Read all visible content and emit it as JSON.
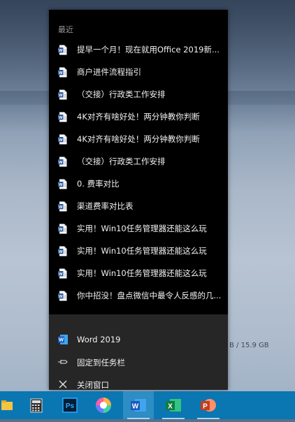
{
  "jumplist": {
    "section_title": "最近",
    "recent_items": [
      {
        "label": "提早一个月！现在就用Office 2019新",
        "ellipsis": "..."
      },
      {
        "label": "商户进件流程指引",
        "ellipsis": ""
      },
      {
        "label": "（交接）行政类工作安排",
        "ellipsis": ""
      },
      {
        "label": "4K对齐有啥好处！两分钟教你判断",
        "ellipsis": ""
      },
      {
        "label": "4K对齐有啥好处！两分钟教你判断",
        "ellipsis": ""
      },
      {
        "label": "（交接）行政类工作安排",
        "ellipsis": ""
      },
      {
        "label": "0. 费率对比",
        "ellipsis": ""
      },
      {
        "label": "渠道费率对比表",
        "ellipsis": ""
      },
      {
        "label": "实用！Win10任务管理器还能这么玩",
        "ellipsis": ""
      },
      {
        "label": "实用！Win10任务管理器还能这么玩",
        "ellipsis": ""
      },
      {
        "label": "实用！Win10任务管理器还能这么玩",
        "ellipsis": ""
      },
      {
        "label": "你中招没！盘点微信中最令人反感的几",
        "ellipsis": "..."
      }
    ],
    "app_label": "Word 2019",
    "pin_label": "固定到任务栏",
    "close_label": "关闭窗口"
  },
  "background": {
    "storage_text": "B / 15.9  GB"
  },
  "taskbar": {
    "apps": [
      "file-explorer-icon",
      "calculator-icon",
      "photoshop-icon",
      "color-app-icon",
      "word-icon",
      "excel-icon",
      "powerpoint-icon"
    ],
    "word_letter": "W",
    "excel_letter": "X",
    "ppt_letter": "P",
    "ps_letters": "Ps"
  },
  "colors": {
    "word_blue": "#2b579a",
    "excel_green": "#217346",
    "ppt_orange": "#d24726",
    "taskbar": "#0a77b3"
  }
}
